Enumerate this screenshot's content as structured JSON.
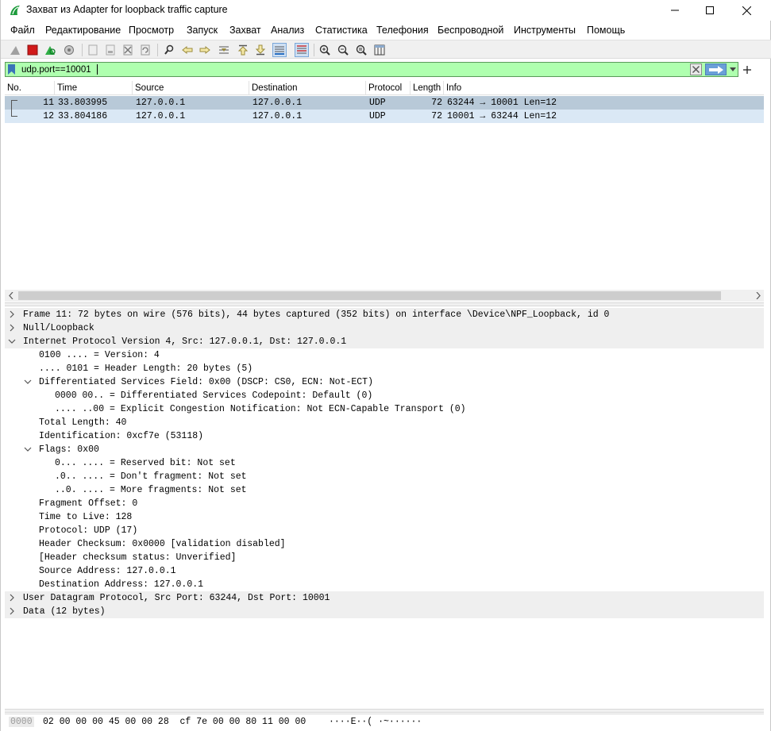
{
  "window": {
    "title": "Захват из Adapter for loopback traffic capture",
    "minimize_glyph": "—",
    "maximize_glyph": "☐",
    "close_glyph": "✕"
  },
  "menu": [
    "Файл",
    "Редактирование",
    "Просмотр",
    "Запуск",
    "Захват",
    "Анализ",
    "Статистика",
    "Телефония",
    "Беспроводной",
    "Инструменты",
    "Помощь"
  ],
  "toolbar": {
    "icons": [
      "shark-fin-start-icon",
      "stop-capture-icon",
      "restart-capture-icon",
      "capture-options-icon",
      "open-file-icon",
      "save-file-icon",
      "close-file-icon",
      "reload-file-icon",
      "find-packet-icon",
      "go-back-icon",
      "go-forward-icon",
      "go-to-packet-icon",
      "go-first-icon",
      "go-last-icon",
      "auto-scroll-icon",
      "colorize-icon",
      "zoom-in-icon",
      "zoom-out-icon",
      "normal-size-icon",
      "resize-columns-icon"
    ]
  },
  "filter": {
    "value": "udp.port==10001",
    "accent": "#afffaf"
  },
  "packet_list": {
    "columns": [
      "No.",
      "Time",
      "Source",
      "Destination",
      "Protocol",
      "Length",
      "Info"
    ],
    "rows": [
      {
        "no": "11",
        "time": "33.803995",
        "source": "127.0.0.1",
        "destination": "127.0.0.1",
        "protocol": "UDP",
        "length": "72",
        "info": "63244 → 10001 Len=12"
      },
      {
        "no": "12",
        "time": "33.804186",
        "source": "127.0.0.1",
        "destination": "127.0.0.1",
        "protocol": "UDP",
        "length": "72",
        "info": "10001 → 63244 Len=12"
      }
    ]
  },
  "details": [
    {
      "text": "Frame 11: 72 bytes on wire (576 bits), 44 bytes captured (352 bits) on interface \\Device\\NPF_Loopback, id 0",
      "arrow": "right"
    },
    {
      "text": "Null/Loopback",
      "arrow": "right"
    },
    {
      "text": "Internet Protocol Version 4, Src: 127.0.0.1, Dst: 127.0.0.1",
      "arrow": "down"
    },
    {
      "text": "0100 .... = Version: 4",
      "arrow": ""
    },
    {
      "text": ".... 0101 = Header Length: 20 bytes (5)",
      "arrow": ""
    },
    {
      "text": "Differentiated Services Field: 0x00 (DSCP: CS0, ECN: Not-ECT)",
      "arrow": "down"
    },
    {
      "text": "0000 00.. = Differentiated Services Codepoint: Default (0)",
      "arrow": ""
    },
    {
      "text": ".... ..00 = Explicit Congestion Notification: Not ECN-Capable Transport (0)",
      "arrow": ""
    },
    {
      "text": "Total Length: 40",
      "arrow": ""
    },
    {
      "text": "Identification: 0xcf7e (53118)",
      "arrow": ""
    },
    {
      "text": "Flags: 0x00",
      "arrow": "down"
    },
    {
      "text": "0... .... = Reserved bit: Not set",
      "arrow": ""
    },
    {
      "text": ".0.. .... = Don't fragment: Not set",
      "arrow": ""
    },
    {
      "text": "..0. .... = More fragments: Not set",
      "arrow": ""
    },
    {
      "text": "Fragment Offset: 0",
      "arrow": ""
    },
    {
      "text": "Time to Live: 128",
      "arrow": ""
    },
    {
      "text": "Protocol: UDP (17)",
      "arrow": ""
    },
    {
      "text": "Header Checksum: 0x0000 [validation disabled]",
      "arrow": ""
    },
    {
      "text": "[Header checksum status: Unverified]",
      "arrow": ""
    },
    {
      "text": "Source Address: 127.0.0.1",
      "arrow": ""
    },
    {
      "text": "Destination Address: 127.0.0.1",
      "arrow": ""
    },
    {
      "text": "User Datagram Protocol, Src Port: 63244, Dst Port: 10001",
      "arrow": "right"
    },
    {
      "text": "Data (12 bytes)",
      "arrow": "right"
    }
  ],
  "bytes": {
    "offset": "0000",
    "hex": "02 00 00 00 45 00 00 28  cf 7e 00 00 80 11 00 00",
    "ascii": "····E··( ·~······"
  }
}
